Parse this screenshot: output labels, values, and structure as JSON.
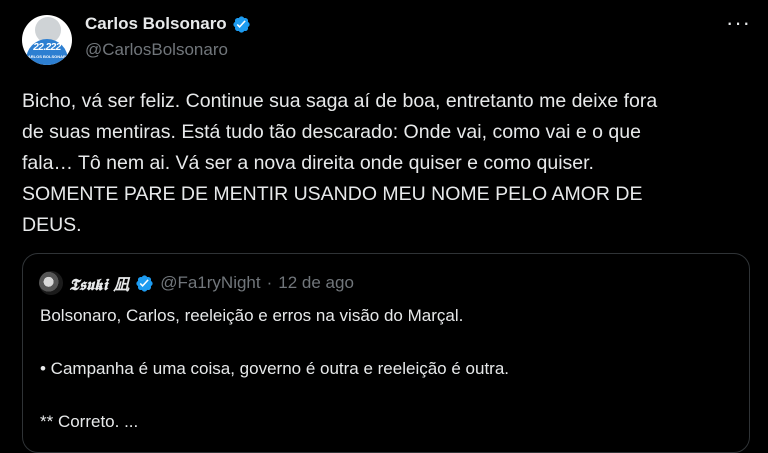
{
  "author": {
    "display_name": "Carlos Bolsonaro",
    "handle": "@CarlosBolsonaro",
    "avatar_number": "22.222",
    "avatar_caption": "CARLOS BOLSONARO"
  },
  "more_glyph": "···",
  "tweet": {
    "lines": [
      "Bicho, vá ser feliz. Continue sua saga aí de boa, entretanto me deixe fora",
      "de suas mentiras. Está tudo tão descarado: Onde vai, como vai e o que",
      "fala… Tô nem ai. Vá ser a nova direita onde quiser e como quiser.",
      "SOMENTE PARE DE MENTIR USANDO MEU NOME PELO AMOR DE",
      "DEUS."
    ]
  },
  "quoted": {
    "display_name": "𝕿𝖘𝖚𝖐𝖎 凪",
    "handle": "@Fa1ryNight",
    "separator": "·",
    "date": "12 de ago",
    "lines": [
      "Bolsonaro, Carlos, reeleição e erros na visão do Marçal.",
      "• Campanha é uma coisa, governo é outra e reeleição é outra.",
      "** Correto. ..."
    ]
  },
  "colors": {
    "background": "#000000",
    "text": "#e7e9ea",
    "muted": "#71767b",
    "verified": "#1d9bf0",
    "border": "#2f3336"
  }
}
